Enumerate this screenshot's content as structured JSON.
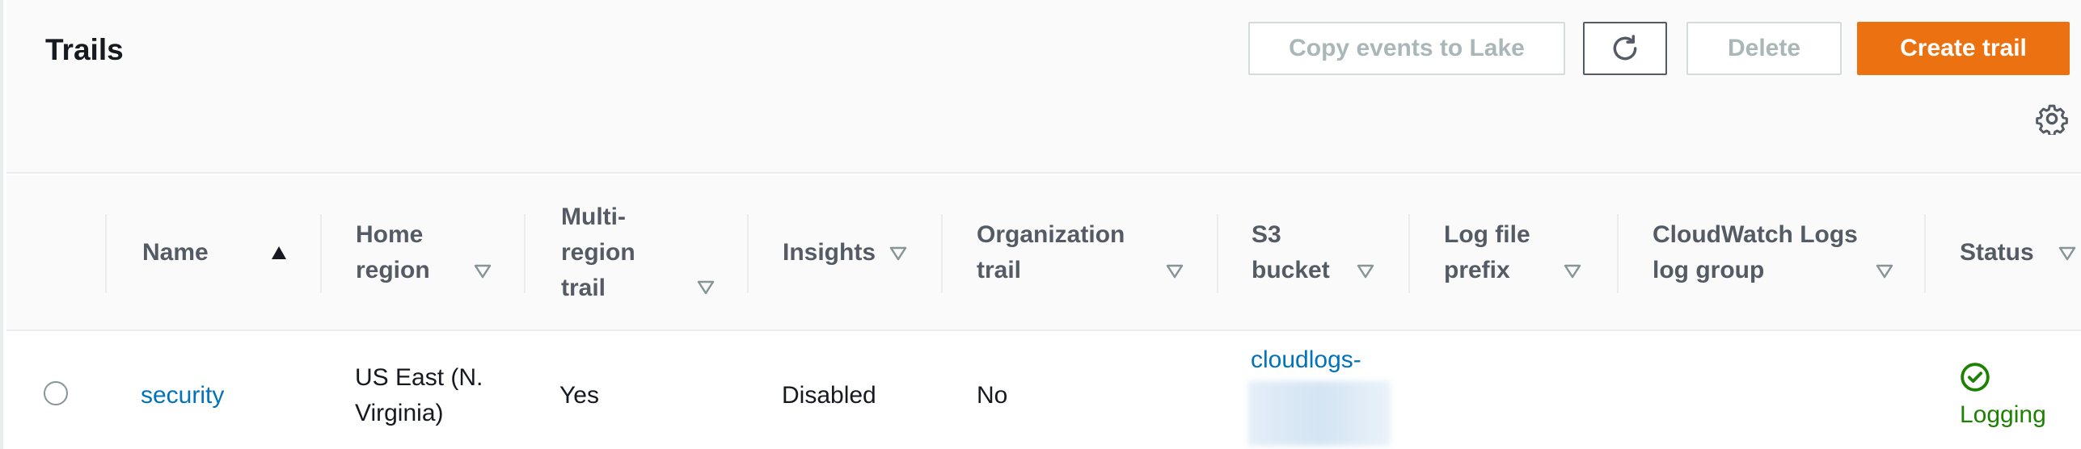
{
  "header": {
    "title": "Trails",
    "buttons": {
      "copy_events": "Copy events to Lake",
      "delete": "Delete",
      "create_trail": "Create trail"
    },
    "icons": {
      "refresh": "refresh-icon",
      "settings": "gear-icon"
    }
  },
  "table": {
    "columns": [
      {
        "label_lines": [
          "Name"
        ],
        "sort": "ascending"
      },
      {
        "label_lines": [
          "Home",
          "region"
        ],
        "sort": "none"
      },
      {
        "label_lines": [
          "Multi-",
          "region",
          "trail"
        ],
        "sort": "none"
      },
      {
        "label_lines": [
          "Insights"
        ],
        "sort": "none"
      },
      {
        "label_lines": [
          "Organization",
          "trail"
        ],
        "sort": "none"
      },
      {
        "label_lines": [
          "S3",
          "bucket"
        ],
        "sort": "none"
      },
      {
        "label_lines": [
          "Log file",
          "prefix"
        ],
        "sort": "none"
      },
      {
        "label_lines": [
          "CloudWatch Logs",
          "log group"
        ],
        "sort": "none"
      },
      {
        "label_lines": [
          "Status"
        ],
        "sort": "none"
      }
    ],
    "rows": [
      {
        "name": "security",
        "home_region_line1": "US East (N.",
        "home_region_line2": "Virginia)",
        "multi_region": "Yes",
        "insights": "Disabled",
        "organization": "No",
        "s3_bucket": "cloudlogs-",
        "log_file_prefix": "",
        "cloudwatch_log_group": "",
        "status": "Logging"
      }
    ]
  },
  "colors": {
    "primary": "#ec7211",
    "link": "#0073bb",
    "success": "#1d8102",
    "disabled_text": "#aab7b8"
  }
}
